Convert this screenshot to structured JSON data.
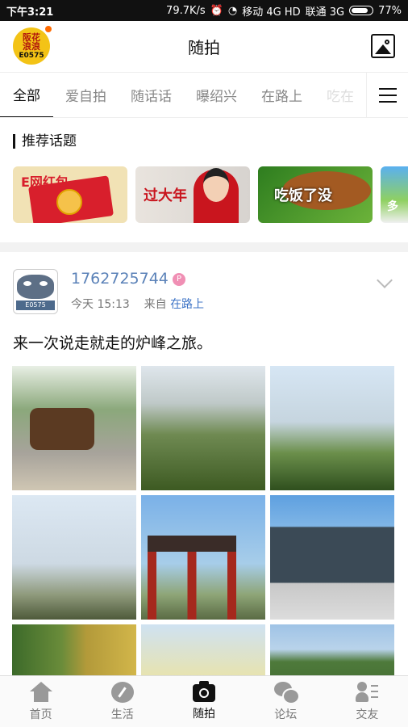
{
  "status_bar": {
    "time": "下午3:21",
    "network_speed": "79.7K/s",
    "carrier1": "移动 4G HD",
    "carrier2": "联通 3G",
    "battery": "77%"
  },
  "header": {
    "logo_line1": "阪花",
    "logo_line2": "浪浪",
    "logo_sub": "E0575",
    "title": "随拍"
  },
  "tabs": [
    {
      "label": "全部",
      "active": true
    },
    {
      "label": "爱自拍"
    },
    {
      "label": "随话话"
    },
    {
      "label": "曝绍兴"
    },
    {
      "label": "在路上"
    },
    {
      "label": "吃在"
    }
  ],
  "topics": {
    "title": "推荐话题",
    "cards": [
      {
        "label": "E网红包"
      },
      {
        "label": "过大年"
      },
      {
        "label": "吃饭了没"
      },
      {
        "label": "多"
      }
    ]
  },
  "post": {
    "avatar_tag": "E0575",
    "username": "1762725744",
    "badge": "P",
    "time": "今天 15:13",
    "from_label": "来自",
    "place": "在路上",
    "text": "来一次说走就走的炉峰之旅。"
  },
  "bottom_nav": [
    {
      "label": "首页",
      "icon": "home-icon"
    },
    {
      "label": "生活",
      "icon": "compass-icon"
    },
    {
      "label": "随拍",
      "icon": "camera-icon",
      "active": true
    },
    {
      "label": "论坛",
      "icon": "chat-icon"
    },
    {
      "label": "交友",
      "icon": "contacts-icon"
    }
  ]
}
